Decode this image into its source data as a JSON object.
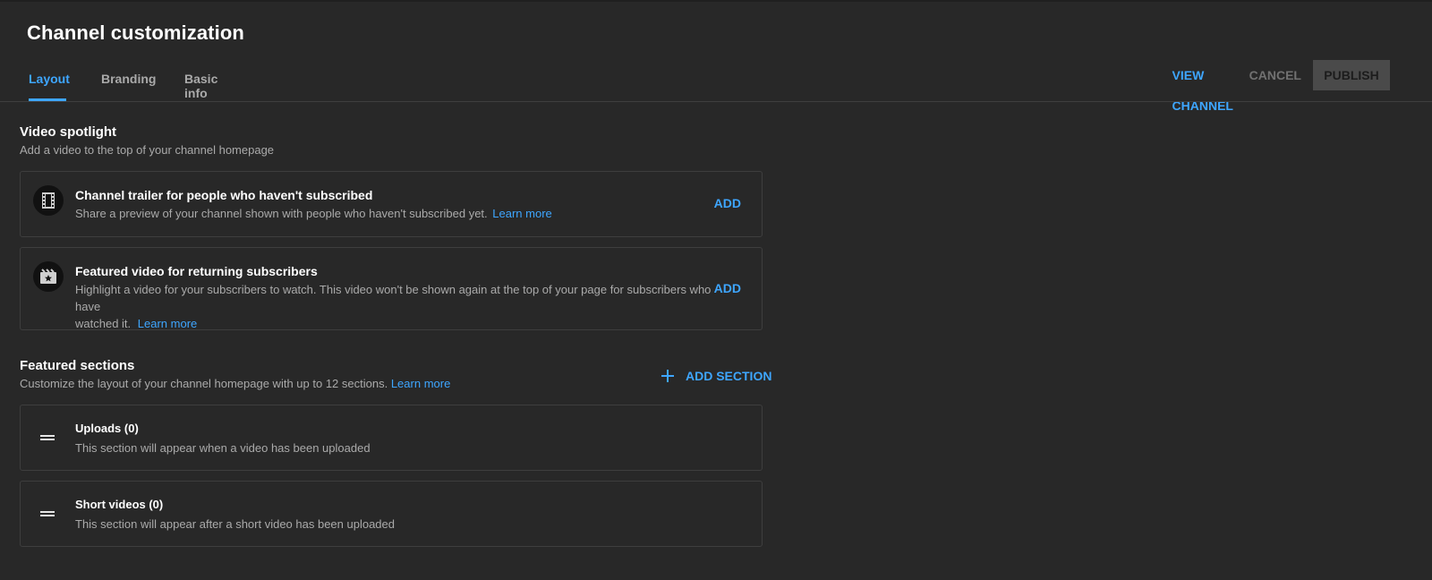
{
  "header": {
    "title": "Channel customization",
    "tabs": [
      {
        "label": "Layout",
        "active": true
      },
      {
        "label": "Branding",
        "active": false
      },
      {
        "label": "Basic info",
        "active": false
      }
    ],
    "actions": {
      "view_channel": "VIEW CHANNEL",
      "cancel": "CANCEL",
      "publish": "PUBLISH"
    }
  },
  "video_spotlight": {
    "heading": "Video spotlight",
    "description": "Add a video to the top of your channel homepage",
    "cards": [
      {
        "icon": "film-icon",
        "title": "Channel trailer for people who haven't subscribed",
        "description": "Share a preview of your channel shown with people who haven't subscribed yet.",
        "learn_more": "Learn more",
        "action": "ADD"
      },
      {
        "icon": "featured-video-icon",
        "title": "Featured video for returning subscribers",
        "description_line1": "Highlight a video for your subscribers to watch. This video won't be shown again at the top of your page for subscribers who have",
        "description_line2": "watched it.",
        "learn_more": "Learn more",
        "action": "ADD"
      }
    ]
  },
  "featured_sections": {
    "heading": "Featured sections",
    "description": "Customize the layout of your channel homepage with up to 12 sections.",
    "learn_more": "Learn more",
    "add_section": "ADD SECTION",
    "sections": [
      {
        "title": "Uploads (0)",
        "description": "This section will appear when a video has been uploaded"
      },
      {
        "title": "Short videos (0)",
        "description": "This section will appear after a short video has been uploaded"
      }
    ]
  },
  "colors": {
    "background": "#282828",
    "accent": "#3ea6ff",
    "border": "#3e3e3e",
    "secondary_text": "#aaaaaa"
  }
}
